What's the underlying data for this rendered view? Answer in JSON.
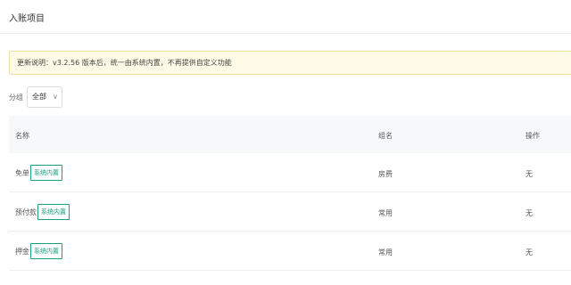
{
  "header": {
    "title": "入账项目"
  },
  "notice": {
    "text": "更新说明：v3.2.56 版本后，统一由系统内置，不再提供自定义功能"
  },
  "filter": {
    "label": "分组",
    "selected": "全部",
    "chevron_icon": "chevron-down-icon"
  },
  "table": {
    "columns": {
      "name": "名称",
      "status": "组名",
      "op": "操作"
    },
    "rows": [
      {
        "name": "免单",
        "tag": "系统内置",
        "status": "房费",
        "op": "无"
      },
      {
        "name": "预付款",
        "tag": "系统内置",
        "status": "常用",
        "op": "无"
      },
      {
        "name": "押金",
        "tag": "系统内置",
        "status": "常用",
        "op": "无"
      }
    ]
  },
  "colors": {
    "tag": "#1aa07a",
    "notice_bg": "#fffbe6",
    "notice_border": "#f3e2a2",
    "header_row_bg": "#f7f8fa"
  }
}
